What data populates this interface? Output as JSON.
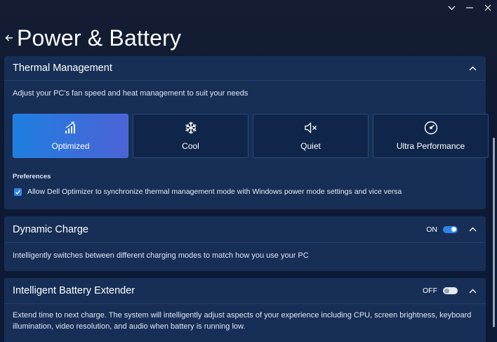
{
  "window": {
    "controls": [
      "chevron-down-icon",
      "minimize-icon",
      "close-icon"
    ]
  },
  "header": {
    "title": "Power & Battery"
  },
  "thermal": {
    "title": "Thermal Management",
    "description": "Adjust your PC's fan speed and heat management to suit your needs",
    "modes": [
      {
        "label": "Optimized",
        "icon": "signal-bars-icon",
        "selected": true
      },
      {
        "label": "Cool",
        "icon": "snowflake-icon",
        "selected": false
      },
      {
        "label": "Quiet",
        "icon": "mute-icon",
        "selected": false
      },
      {
        "label": "Ultra Performance",
        "icon": "gauge-icon",
        "selected": false
      }
    ],
    "preferences_title": "Preferences",
    "sync_label": "Allow Dell Optimizer to synchronize thermal management mode with Windows power mode settings and vice versa",
    "sync_checked": true
  },
  "dynamic_charge": {
    "title": "Dynamic Charge",
    "toggle_label": "ON",
    "enabled": true,
    "description": "Intelligently switches between different charging modes to match how you use your PC"
  },
  "battery_extender": {
    "title": "Intelligent Battery Extender",
    "toggle_label": "OFF",
    "enabled": false,
    "description_line1": "Extend time to next charge. The system will intelligently adjust aspects of your experience including CPU, screen brightness, keyboard",
    "description_line2": "illumination, video resolution, and audio when battery is running low."
  },
  "colors": {
    "accent": "#2f86e6",
    "card": "#172f57",
    "background": "#0f1a32"
  }
}
